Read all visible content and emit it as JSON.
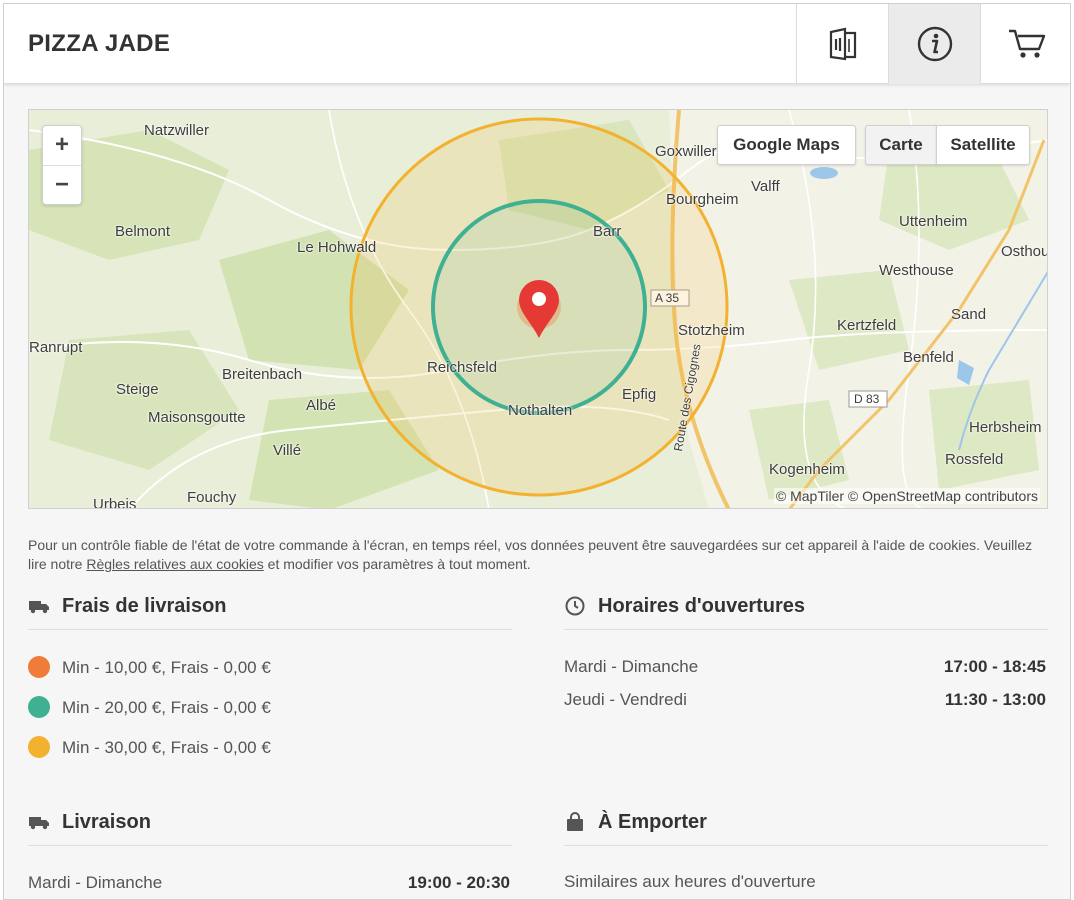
{
  "header": {
    "title": "PIZZA JADE"
  },
  "map": {
    "zoom_in": "+",
    "zoom_out": "−",
    "google_maps": "Google Maps",
    "carte": "Carte",
    "satellite": "Satellite",
    "attribution": "© MapTiler © OpenStreetMap contributors",
    "places": [
      "Natzwiller",
      "Goxwiller",
      "Valff",
      "Bourgheim",
      "Belmont",
      "Le Hohwald",
      "Barr",
      "Uttenheim",
      "Osthou",
      "Westhouse",
      "Ranrupt",
      "Stotzheim",
      "Kertzfeld",
      "Sand",
      "Benfeld",
      "Reichsfeld",
      "Breitenbach",
      "Steige",
      "Albé",
      "Maisonsgoutte",
      "Epfig",
      "Nothalten",
      "Villé",
      "Herbsheim",
      "Rossfeld",
      "Kogenheim",
      "Fouchy",
      "Urbeis"
    ],
    "road_labels": [
      "A 35",
      "D 83",
      "Route des Cigognes"
    ]
  },
  "cookie": {
    "text_before": "Pour un contrôle fiable de l'état de votre commande à l'écran, en temps réel, vos données peuvent être sauvegardées sur cet appareil à l'aide de cookies. Veuillez lire notre ",
    "link": "Règles relatives aux cookies",
    "text_after": " et modifier vos paramètres à tout moment."
  },
  "delivery_fees": {
    "heading": "Frais de livraison",
    "zones": [
      {
        "label": "Min - 10,00 €, Frais - 0,00 €",
        "color": "#f07c3a"
      },
      {
        "label": "Min - 20,00 €, Frais - 0,00 €",
        "color": "#3fb092"
      },
      {
        "label": "Min - 30,00 €, Frais - 0,00 €",
        "color": "#f2b230"
      }
    ]
  },
  "opening_hours": {
    "heading": "Horaires d'ouvertures",
    "rows": [
      {
        "days": "Mardi - Dimanche",
        "hours": "17:00 - 18:45"
      },
      {
        "days": "Jeudi - Vendredi",
        "hours": "11:30 - 13:00"
      }
    ]
  },
  "delivery": {
    "heading": "Livraison",
    "rows": [
      {
        "days": "Mardi - Dimanche",
        "hours": "19:00 - 20:30"
      }
    ]
  },
  "takeaway": {
    "heading": "À Emporter",
    "text": "Similaires aux heures d'ouverture"
  },
  "colors": {
    "zone_outer": "#f2b230",
    "zone_inner": "#3fb092",
    "marker": "#e53935"
  }
}
